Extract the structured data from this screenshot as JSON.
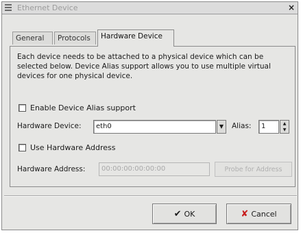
{
  "window": {
    "title": "Ethernet Device"
  },
  "tabs": [
    {
      "label": "General"
    },
    {
      "label": "Protocols"
    },
    {
      "label": "Hardware Device"
    }
  ],
  "description": "Each device needs to be attached to a physical device which can be selected below. Device Alias support allows you to use multiple virtual devices for one physical device.",
  "alias_support": {
    "label": "Enable Device Alias support",
    "checked": false
  },
  "hardware_device": {
    "label": "Hardware Device:",
    "value": "eth0"
  },
  "alias": {
    "label": "Alias:",
    "value": "1"
  },
  "use_hw_address": {
    "label": "Use Hardware Address",
    "checked": false
  },
  "hw_address": {
    "label": "Hardware Address:",
    "value": "00:00:00:00:00:00"
  },
  "probe_button": {
    "label": "Probe for Address"
  },
  "ok_button": {
    "label": "OK"
  },
  "cancel_button": {
    "label": "Cancel"
  }
}
